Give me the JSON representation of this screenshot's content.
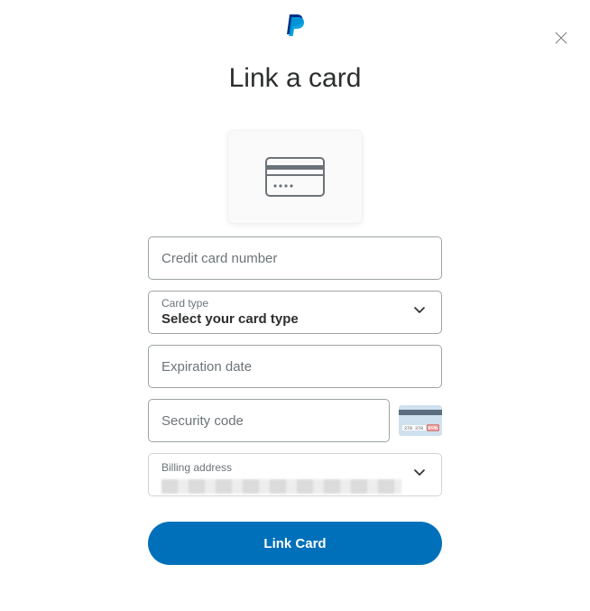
{
  "title": "Link a card",
  "close_icon": "close",
  "card_illustration": "credit-card",
  "fields": {
    "card_number": {
      "placeholder": "Credit card number",
      "value": ""
    },
    "card_type": {
      "label": "Card type",
      "value": "Select your card type"
    },
    "expiration": {
      "placeholder": "Expiration date",
      "value": ""
    },
    "security_code": {
      "placeholder": "Security code",
      "value": ""
    },
    "billing_address": {
      "label": "Billing address"
    }
  },
  "button": {
    "submit_label": "Link Card"
  }
}
